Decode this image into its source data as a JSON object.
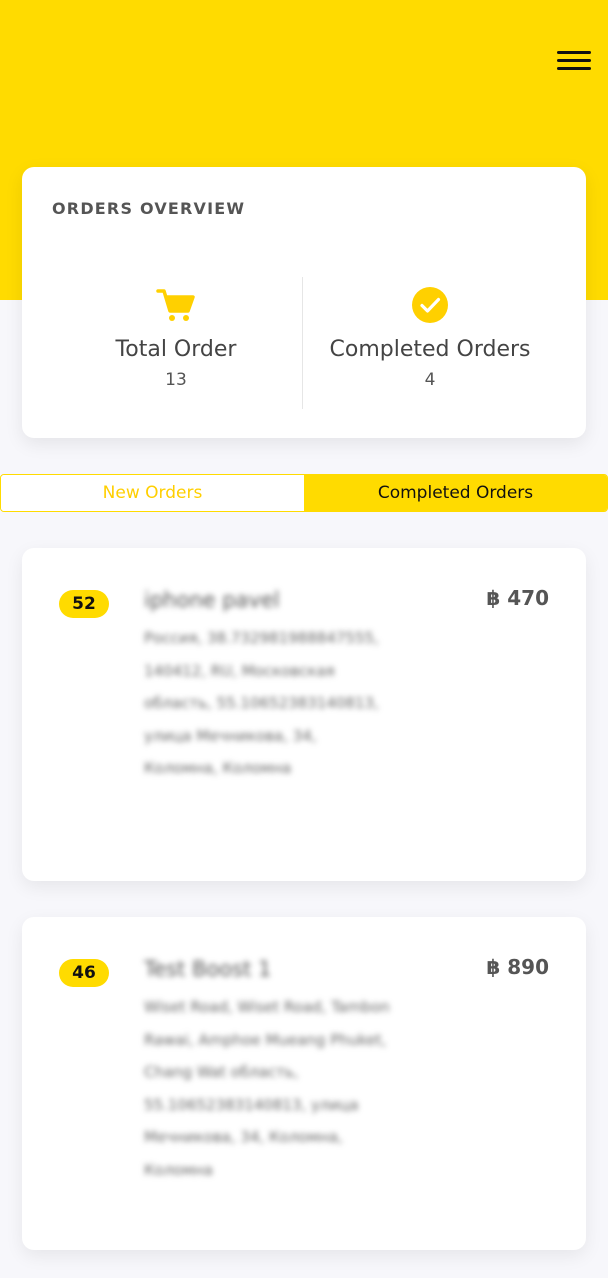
{
  "colors": {
    "brand_yellow": "#ffdb00",
    "background": "#f7f7fb",
    "card": "#ffffff"
  },
  "header": {
    "menu_icon": "hamburger-icon"
  },
  "overview": {
    "title": "ORDERS OVERVIEW",
    "stats": [
      {
        "icon": "cart-icon",
        "label": "Total Order",
        "value": "13"
      },
      {
        "icon": "check-circle-icon",
        "label": "Completed Orders",
        "value": "4"
      }
    ]
  },
  "tabs": {
    "new_label": "New Orders",
    "completed_label": "Completed Orders",
    "active": "Completed Orders"
  },
  "orders": [
    {
      "number": "52",
      "name": "iphone pavel",
      "address": "Россия, 38.732981988847555, 140412, RU, Московская область, 55.10652383140813, улица Мечникова, 34, Коломна, Коломна",
      "price": "฿ 470"
    },
    {
      "number": "46",
      "name": "Test Boost 1",
      "address": "Wiset Road, Wiset Road, Tambon Rawai, Amphoe Mueang Phuket, Chang Wat область, 55.10652383140813, улица Мечникова, 34, Коломна, Коломна",
      "price": "฿ 890"
    }
  ]
}
